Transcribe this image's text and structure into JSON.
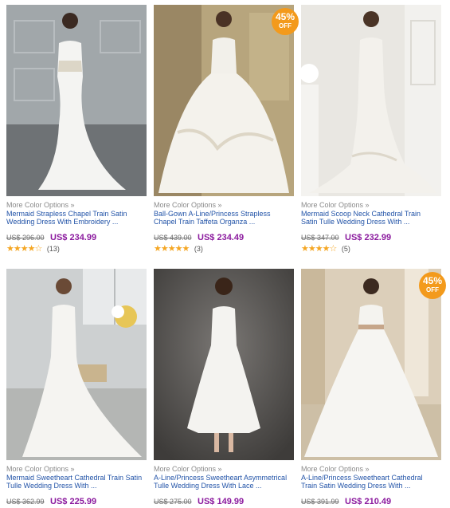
{
  "products": [
    {
      "more": "More Color Options »",
      "title": "Mermaid Strapless Chapel Train Satin\nWedding Dress With Embroidery ...",
      "old_price": "US$ 296.00",
      "price": "US$ 234.99",
      "rating": "★★★★☆",
      "reviews": "(13)",
      "badge": null,
      "bg": "#8e9599"
    },
    {
      "more": "More Color Options »",
      "title": "Ball-Gown A-Line/Princess Strapless\nChapel Train Taffeta Organza ...",
      "old_price": "US$ 439.00",
      "price": "US$ 234.49",
      "rating": "★★★★★",
      "reviews": "(3)",
      "badge": {
        "pct": "45%",
        "off": "OFF"
      },
      "bg": "#b9a77f"
    },
    {
      "more": "More Color Options »",
      "title": "Mermaid Scoop Neck Cathedral Train\nSatin Tulle Wedding Dress With ...",
      "old_price": "US$ 347.00",
      "price": "US$ 232.99",
      "rating": "★★★★☆",
      "reviews": "(5)",
      "badge": null,
      "bg": "#e6e4df"
    },
    {
      "more": "More Color Options »",
      "title": "Mermaid Sweetheart Cathedral Train Satin\nTulle Wedding Dress With ...",
      "old_price": "US$ 362.99",
      "price": "US$ 225.99",
      "rating": "",
      "reviews": "",
      "badge": null,
      "bg": "#cfd2d3"
    },
    {
      "more": "More Color Options »",
      "title": "A-Line/Princess Sweetheart Asymmetrical\nTulle Wedding Dress With Lace ...",
      "old_price": "US$ 275.00",
      "price": "US$ 149.99",
      "rating": "",
      "reviews": "",
      "badge": null,
      "bg": "#5c5a58"
    },
    {
      "more": "More Color Options »",
      "title": "A-Line/Princess Sweetheart Cathedral\nTrain Satin Wedding Dress With ...",
      "old_price": "US$ 391.99",
      "price": "US$ 210.49",
      "rating": "",
      "reviews": "",
      "badge": {
        "pct": "45%",
        "off": "OFF"
      },
      "bg": "#d9cdb9"
    }
  ],
  "icons": {
    "star": "star-icon",
    "sale": "sale-badge"
  }
}
